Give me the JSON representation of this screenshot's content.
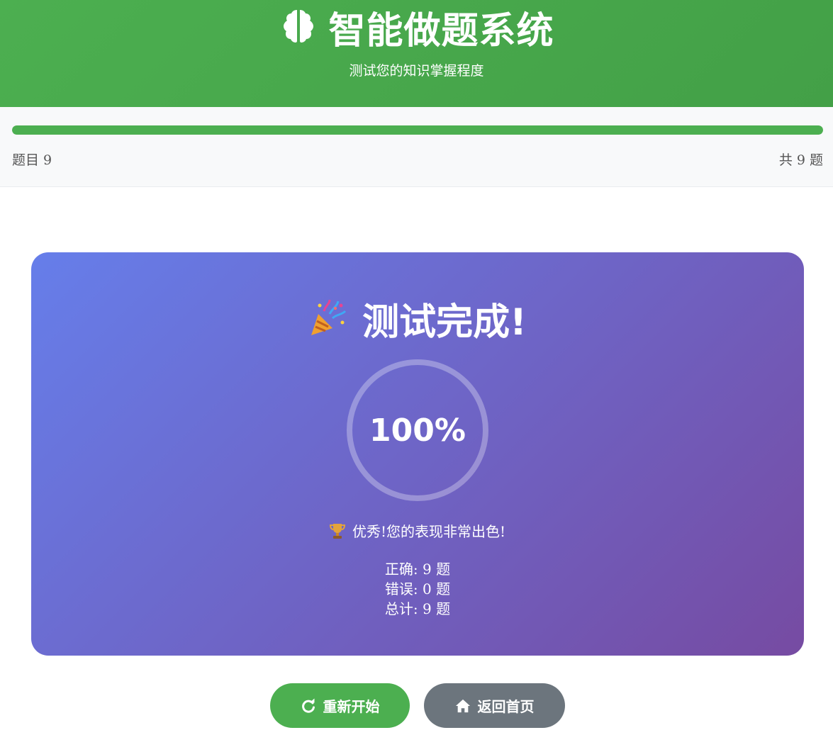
{
  "header": {
    "icon": "brain-icon",
    "title": "智能做题系统",
    "subtitle": "测试您的知识掌握程度"
  },
  "progress": {
    "fraction": 1.0,
    "current_label": "题目 9",
    "total_label": "共 9 题",
    "bar_color": "#4caf50"
  },
  "result": {
    "icon": "party-popper-icon",
    "title": "测试完成!",
    "score": "100%",
    "message_icon": "trophy-icon",
    "message": "优秀!您的表现非常出色!",
    "stats": [
      "正确: 9 题",
      "错误: 0 题",
      "总计: 9 题"
    ],
    "gradient_start": "#667eea",
    "gradient_end": "#764ba2"
  },
  "actions": {
    "restart_icon": "redo-icon",
    "restart_label": "重新开始",
    "home_icon": "home-icon",
    "home_label": "返回首页"
  }
}
